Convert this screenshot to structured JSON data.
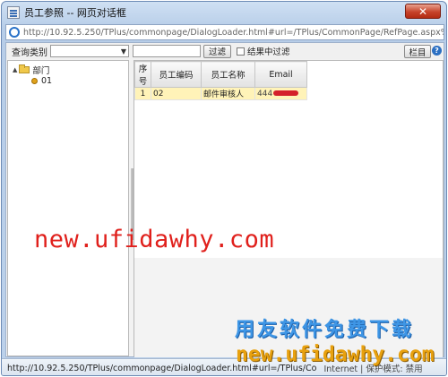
{
  "window": {
    "title": "员工参照 -- 网页对话框",
    "close_label": "✕",
    "address_url": "http://10.92.5.250/TPlus/commonpage/DialogLoader.html#url=/TPlus/CommonPage/RefPage.aspx%3FrefPopXml%3Dtrue%2"
  },
  "toolbar": {
    "query_label": "查询类别",
    "query_select_value": "",
    "search_value": "",
    "filter_button": "过滤",
    "in_result_filter_label": "结果中过滤",
    "ok_button": "栏目",
    "help_icon": "?"
  },
  "tree": {
    "root": {
      "toggle": "▲",
      "label": "部门"
    },
    "child": {
      "label": "01"
    }
  },
  "grid": {
    "columns": [
      "序号",
      "员工编码",
      "员工名称",
      "Email"
    ],
    "rows": [
      {
        "index": "1",
        "code": "02",
        "name": "邮件审核人",
        "email_prefix": "444"
      }
    ]
  },
  "statusbar": {
    "url": "http://10.92.5.250/TPlus/commonpage/DialogLoader.html#url=/TPlus/Co",
    "zone": "Internet | 保护模式: 禁用"
  },
  "watermarks": {
    "main": "new.ufidawhy.com",
    "cn": "用友软件免费下载",
    "en": "new.ufidawhy.com"
  }
}
